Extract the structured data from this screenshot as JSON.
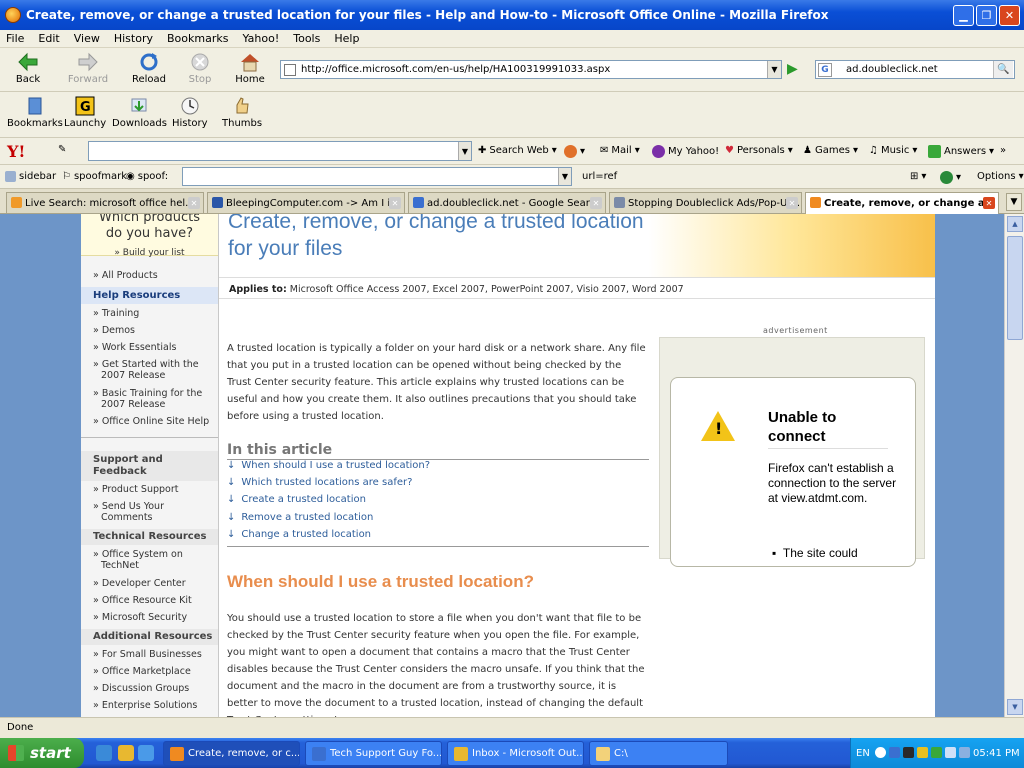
{
  "window": {
    "title": "Create, remove, or change a trusted location for your files - Help and How-to - Microsoft Office Online - Mozilla Firefox"
  },
  "menu": [
    "File",
    "Edit",
    "View",
    "History",
    "Bookmarks",
    "Yahoo!",
    "Tools",
    "Help"
  ],
  "nav": {
    "back": "Back",
    "forward": "Forward",
    "reload": "Reload",
    "stop": "Stop",
    "home": "Home",
    "url": "http://office.microsoft.com/en-us/help/HA100319991033.aspx",
    "search_value": "ad.doubleclick.net"
  },
  "bookmarks_toolbar": [
    "Bookmarks",
    "Launchy",
    "Downloads",
    "History",
    "Thumbs"
  ],
  "yahoo_toolbar": {
    "logo": "Y!",
    "search_web": "Search Web",
    "mail": "Mail",
    "my_yahoo": "My Yahoo!",
    "personals": "Personals",
    "games": "Games",
    "music": "Music",
    "answers": "Answers",
    "more": "»"
  },
  "spoof_toolbar": {
    "sidebar": "sidebar",
    "spoofmark": "spoofmark",
    "spoof_label": "spoof:",
    "url_ref": "url=ref",
    "options": "Options"
  },
  "tabs": [
    {
      "label": "Live Search: microsoft office hel...",
      "color": "#f09a2a"
    },
    {
      "label": "BleepingComputer.com -> Am I i...",
      "color": "#2a56a8"
    },
    {
      "label": "ad.doubleclick.net - Google Search",
      "color": "#3a6fd0"
    },
    {
      "label": "Stopping Doubleclick Ads/Pop-Up...",
      "color": "#7a8aa8"
    },
    {
      "label": "Create, remove, or change a...",
      "color": "#f08a20"
    }
  ],
  "page": {
    "title_line1": "Create, remove, or change a trusted location",
    "title_line2": "for your files",
    "applies_to_label": "Applies to:",
    "applies_to_value": "Microsoft Office Access 2007, Excel 2007, PowerPoint 2007, Visio 2007, Word 2007",
    "intro": "A trusted location is typically a folder on your hard disk or a network share. Any file that you put in a trusted location can be opened without being checked by the Trust Center security feature. This article explains why trusted locations can be useful and how you create them. It also outlines precautions that you should take before using a trusted location.",
    "toc_heading": "In this article",
    "toc": [
      "When should I use a trusted location?",
      "Which trusted locations are safer?",
      "Create a trusted location",
      "Remove a trusted location",
      "Change a trusted location"
    ],
    "section_heading": "When should I use a trusted location?",
    "section_text": "You should use a trusted location to store a file when you don't want that file to be checked by the Trust Center security feature when you open the file. For example, you might want to open a document that contains a macro that the Trust Center disables because the Trust Center considers the macro unsafe. If you think that the document and the macro in the document are from a trustworthy source, it is better to move the document to a trusted location, instead of changing the default Trust Center settings to",
    "ad_label": "advertisement",
    "ad_title": "Unable to connect",
    "ad_text": "Firefox can't establish a connection to the server at view.atdmt.com.",
    "ad_bullet": "The site could"
  },
  "left_nav": {
    "promo_line1": "Which products",
    "promo_line2": "do you have?",
    "promo_link": "» Build your list",
    "all_products": "» All Products",
    "help_resources": "Help Resources",
    "help_items": [
      "» Training",
      "» Demos",
      "» Work Essentials",
      "» Get Started with the",
      "2007 Release",
      "» Basic Training for the",
      "2007 Release",
      "» Office Online Site Help"
    ],
    "support_heading_1": "Support and",
    "support_heading_2": "Feedback",
    "support_items": [
      "» Product Support",
      "» Send Us Your",
      "Comments"
    ],
    "technical_heading": "Technical Resources",
    "technical_items": [
      "» Office System on",
      "TechNet",
      "» Developer Center",
      "» Office Resource Kit",
      "» Microsoft Security"
    ],
    "additional_heading": "Additional Resources",
    "additional_items": [
      "» For Small Businesses",
      "» Office Marketplace",
      "» Discussion Groups",
      "» Enterprise Solutions"
    ]
  },
  "status": "Done",
  "taskbar": {
    "start": "start",
    "buttons": [
      "Create, remove, or c...",
      "Tech Support Guy Fo...",
      "Inbox - Microsoft Out...",
      "C:\\"
    ],
    "lang": "EN",
    "clock": "05:41 PM"
  }
}
